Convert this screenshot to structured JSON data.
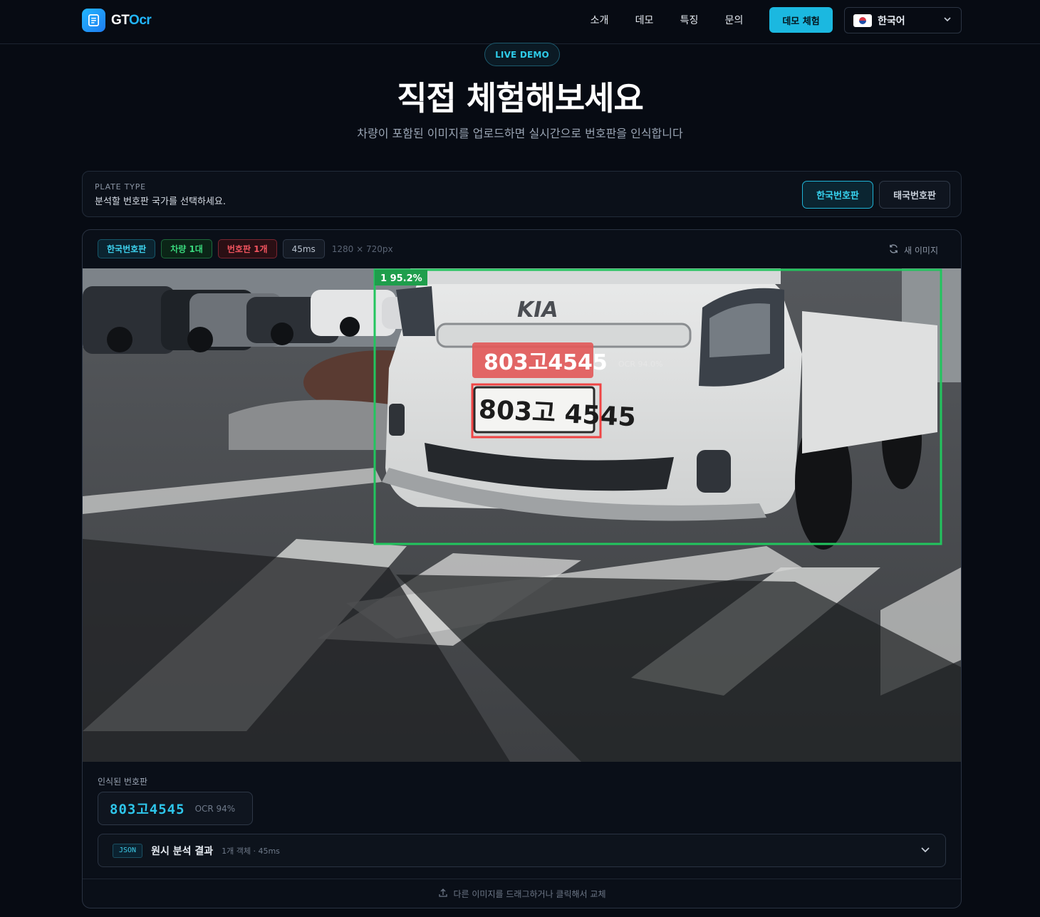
{
  "nav": {
    "brand_part1": "GT",
    "brand_part2": "Ocr",
    "links": [
      "소개",
      "데모",
      "특징",
      "문의"
    ],
    "cta": "데모 체험",
    "language": "한국어"
  },
  "hero": {
    "badge": "LIVE DEMO",
    "title": "직접 체험해보세요",
    "subtitle": "차량이 포함된 이미지를 업로드하면 실시간으로 번호판을 인식합니다"
  },
  "plate_type": {
    "label": "PLATE TYPE",
    "description": "분석할 번호판 국가를 선택하세요.",
    "options": [
      "한국번호판",
      "태국번호판"
    ],
    "selected": "한국번호판"
  },
  "result": {
    "chips": {
      "plate_type": "한국번호판",
      "vehicles": "차량 1대",
      "plates": "번호판 1개",
      "time": "45ms"
    },
    "dimensions": "1280 × 720px",
    "new_image": "새 이미지",
    "overlay": {
      "vehicle_label": "1  95.2%",
      "plate_text": "803고4545",
      "ocr_label": "OCR  94.0%"
    },
    "recognized_label": "인식된 번호판",
    "recognized_plate": "803고4545",
    "recognized_ocr": "OCR 94%",
    "json": {
      "tag": "JSON",
      "title": "원시 분석 결과",
      "meta": "1개 객체 · 45ms"
    },
    "replace_hint": "다른 이미지를 드래그하거나 클릭해서 교체"
  },
  "colors": {
    "accent": "#1bb8e0",
    "vehicle_box": "#22c55e",
    "plate_box": "#ef4444",
    "background": "#070b13"
  }
}
